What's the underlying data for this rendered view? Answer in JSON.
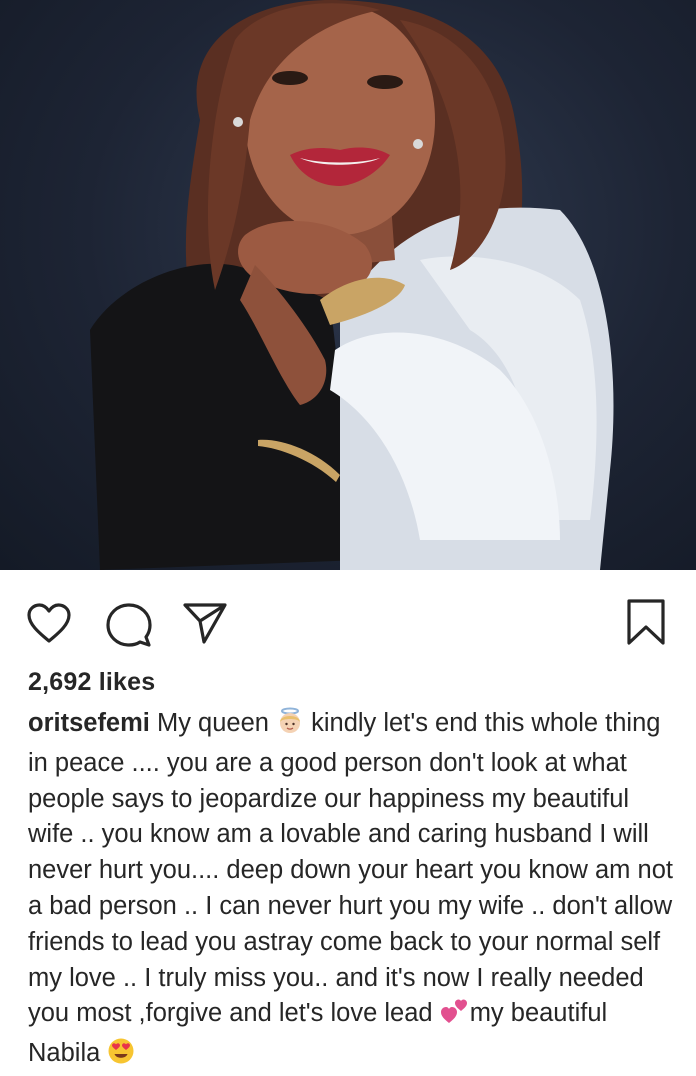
{
  "post": {
    "likes_text": "2,692 likes",
    "username": "oritsefemi",
    "caption_part1": " My queen ",
    "caption_part2": " kindly let's end this whole thing in peace .... you are a good person don't look at what people says to jeopardize our happiness my beautiful wife .. you know am a lovable and caring husband I will never hurt you.... deep down your heart you know am not a bad person .. I can never hurt you my wife .. don't allow friends to lead you astray come back to your normal self my love .. I truly miss you.. and it's now I really needed you most ,forgive and let's love lead ",
    "caption_part3": "my beautiful Nabila ",
    "emojis": [
      "angel-emoji",
      "two-hearts-emoji",
      "heart-eyes-emoji"
    ]
  },
  "icons": {
    "like": "heart-outline-icon",
    "comment": "speech-bubble-icon",
    "share": "paper-plane-icon",
    "save": "bookmark-icon"
  }
}
